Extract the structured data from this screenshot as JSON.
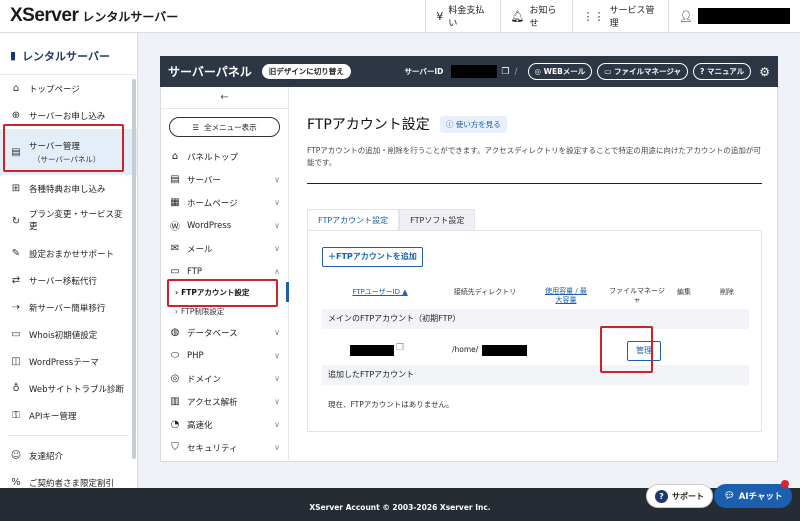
{
  "topbar": {
    "logo_main": "XServer",
    "logo_sub": "レンタルサーバー",
    "nav": [
      {
        "label": "料金支払い",
        "icon": "yen-icon"
      },
      {
        "label": "お知らせ",
        "icon": "bell-icon"
      },
      {
        "label": "サービス管理",
        "icon": "grid-icon"
      }
    ]
  },
  "sidebar": {
    "title": "レンタルサーバー",
    "items": [
      {
        "label": "トップページ",
        "icon": "home-icon"
      },
      {
        "label": "サーバーお申し込み",
        "icon": "plus-circle-icon"
      },
      {
        "label": "サーバー管理",
        "sub": "（サーバーパネル）",
        "icon": "server-icon"
      },
      {
        "label": "各種特典お申し込み",
        "icon": "gift-icon"
      },
      {
        "label": "プラン変更・サービス変更",
        "icon": "refresh-icon"
      },
      {
        "label": "設定おまかせサポート",
        "icon": "wrench-icon"
      },
      {
        "label": "サーバー移転代行",
        "icon": "transfer-icon"
      },
      {
        "label": "新サーバー簡単移行",
        "icon": "move-icon"
      },
      {
        "label": "Whois初期値設定",
        "icon": "id-card-icon"
      },
      {
        "label": "WordPressテーマ",
        "icon": "palette-icon"
      },
      {
        "label": "Webサイトトラブル診断",
        "icon": "stethoscope-icon"
      },
      {
        "label": "APIキー管理",
        "icon": "key-icon"
      },
      {
        "label": "友達紹介",
        "icon": "friend-icon"
      },
      {
        "label": "ご契約者さま限定割引",
        "icon": "discount-icon"
      }
    ]
  },
  "panel_header": {
    "title": "サーバーパネル",
    "old_design": "旧デザインに切り替え",
    "server_id_label": "サーバーID",
    "separator": "/",
    "buttons": [
      "WEBメール",
      "ファイルマネージャ",
      "マニュアル"
    ]
  },
  "panel_sidebar": {
    "back": "←",
    "all_menu": "全メニュー表示",
    "items": [
      {
        "label": "パネルトップ",
        "icon": "home-icon",
        "chev": ""
      },
      {
        "label": "サーバー",
        "icon": "server-icon",
        "chev": "∨"
      },
      {
        "label": "ホームページ",
        "icon": "page-icon",
        "chev": "∨"
      },
      {
        "label": "WordPress",
        "icon": "wordpress-icon",
        "chev": "∨"
      },
      {
        "label": "メール",
        "icon": "mail-icon",
        "chev": "∨"
      },
      {
        "label": "FTP",
        "icon": "folder-icon",
        "chev": "∧"
      }
    ],
    "ftp_subs": [
      "FTPアカウント設定",
      "FTP制限設定"
    ],
    "items2": [
      {
        "label": "データベース",
        "icon": "database-icon",
        "chev": "∨"
      },
      {
        "label": "PHP",
        "icon": "php-icon",
        "chev": "∨"
      },
      {
        "label": "ドメイン",
        "icon": "globe-icon",
        "chev": "∨"
      },
      {
        "label": "アクセス解析",
        "icon": "chart-icon",
        "chev": "∨"
      },
      {
        "label": "高速化",
        "icon": "speed-icon",
        "chev": "∨"
      },
      {
        "label": "セキュリティ",
        "icon": "shield-icon",
        "chev": "∨"
      }
    ]
  },
  "main": {
    "title": "FTPアカウント設定",
    "howto": "使い方を見る",
    "desc": "FTPアカウントの追加・削除を行うことができます。アクセスディレクトリを設定することで特定の用途に向けたアカウントの追加が可能です。",
    "tabs": [
      "FTPアカウント設定",
      "FTPソフト設定"
    ],
    "add_button": "＋FTPアカウントを追加",
    "columns": {
      "user": "FTPユーザーID ▲",
      "dir": "接続先ディレクトリ",
      "usage": "使用容量 / 最大容量",
      "fm": "ファイルマネージャ",
      "edit": "編集",
      "del": "削除"
    },
    "group_main": "メインのFTPアカウント（初期FTP）",
    "row": {
      "dir_prefix": "/home/",
      "manage": "管理"
    },
    "group_added": "追加したFTPアカウント",
    "no_accounts": "現在、FTPアカウントはありません。"
  },
  "footer": {
    "copyright": "XServer Account © 2003-2026 Xserver Inc.",
    "support": "サポート",
    "aichat": "AIチャット"
  }
}
